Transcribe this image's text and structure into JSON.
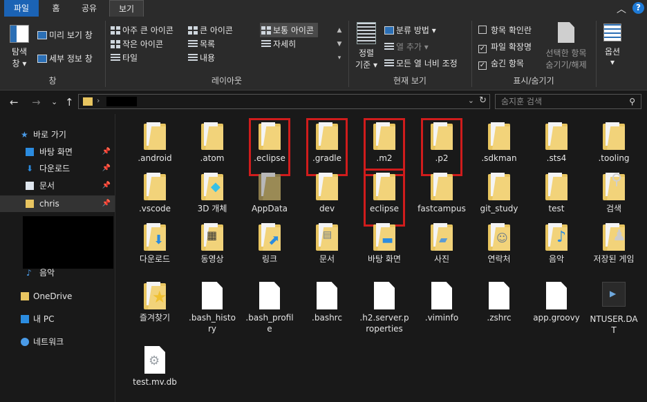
{
  "tabs": {
    "file": "파일",
    "home": "홈",
    "share": "공유",
    "view": "보기"
  },
  "ribbon": {
    "pane": {
      "nav_pane_label": "탐색",
      "nav_pane_label2": "창",
      "preview": "미리 보기 창",
      "details": "세부 정보 창",
      "group": "창"
    },
    "layout": {
      "extra_large": "아주 큰 아이콘",
      "large": "큰 아이콘",
      "medium": "보통 아이콘",
      "small": "작은 아이콘",
      "list": "목록",
      "details": "자세히",
      "tiles": "타일",
      "content": "내용",
      "group": "레이아웃"
    },
    "current": {
      "sort1": "정렬",
      "sort2": "기준",
      "group_by": "분류 방법",
      "add_column": "열 추가",
      "fit_columns": "모든 열 너비 조정",
      "group": "현재 보기"
    },
    "showhide": {
      "item_check": "항목 확인란",
      "ext": "파일 확장명",
      "hidden": "숨긴 항목",
      "hide_sel1": "선택한 항목",
      "hide_sel2": "숨기기/해제",
      "group": "표시/숨기기"
    },
    "options": "옵션"
  },
  "search": {
    "placeholder": "숨지훈 검색"
  },
  "sidebar": {
    "quick": "바로 가기",
    "items": [
      "바탕 화면",
      "다운로드",
      "문서",
      "chris"
    ],
    "music": "음악",
    "onedrive": "OneDrive",
    "pc": "내 PC",
    "network": "네트워크"
  },
  "files": [
    {
      "name": ".android",
      "type": "folder"
    },
    {
      "name": ".atom",
      "type": "folder"
    },
    {
      "name": ".eclipse",
      "type": "folder"
    },
    {
      "name": ".gradle",
      "type": "folder"
    },
    {
      "name": ".m2",
      "type": "folder"
    },
    {
      "name": ".p2",
      "type": "folder"
    },
    {
      "name": ".sdkman",
      "type": "folder"
    },
    {
      "name": ".sts4",
      "type": "folder"
    },
    {
      "name": ".tooling",
      "type": "folder"
    },
    {
      "name": ".vscode",
      "type": "folder"
    },
    {
      "name": "3D 개체",
      "type": "folder3d"
    },
    {
      "name": "AppData",
      "type": "folderdark"
    },
    {
      "name": "dev",
      "type": "folder"
    },
    {
      "name": "eclipse",
      "type": "folder"
    },
    {
      "name": "fastcampus",
      "type": "folder"
    },
    {
      "name": "git_study",
      "type": "folder"
    },
    {
      "name": "test",
      "type": "folder"
    },
    {
      "name": "검색",
      "type": "foldersearch"
    },
    {
      "name": "다운로드",
      "type": "folderdown"
    },
    {
      "name": "동영상",
      "type": "foldervideo"
    },
    {
      "name": "링크",
      "type": "folderlink"
    },
    {
      "name": "문서",
      "type": "folderdoc"
    },
    {
      "name": "바탕 화면",
      "type": "folderdesk"
    },
    {
      "name": "사진",
      "type": "folderpic"
    },
    {
      "name": "연락처",
      "type": "foldercontact"
    },
    {
      "name": "음악",
      "type": "foldermusic"
    },
    {
      "name": "저장된 게임",
      "type": "foldergame"
    },
    {
      "name": "즐겨찾기",
      "type": "folderstar"
    },
    {
      "name": ".bash_history",
      "type": "doc"
    },
    {
      "name": ".bash_profile",
      "type": "doc"
    },
    {
      "name": ".bashrc",
      "type": "doc"
    },
    {
      "name": ".h2.server.properties",
      "type": "doc"
    },
    {
      "name": ".viminfo",
      "type": "doc"
    },
    {
      "name": ".zshrc",
      "type": "doc"
    },
    {
      "name": "app.groovy",
      "type": "doc"
    },
    {
      "name": "NTUSER.DAT",
      "type": "dat"
    },
    {
      "name": "test.mv.db",
      "type": "db"
    }
  ],
  "highlighted": [
    ".eclipse",
    ".gradle",
    ".m2",
    ".p2",
    "eclipse"
  ],
  "colors": {
    "accent": "#1b63b5",
    "highlight": "#d01c1c",
    "folder": "#f2d37a"
  }
}
